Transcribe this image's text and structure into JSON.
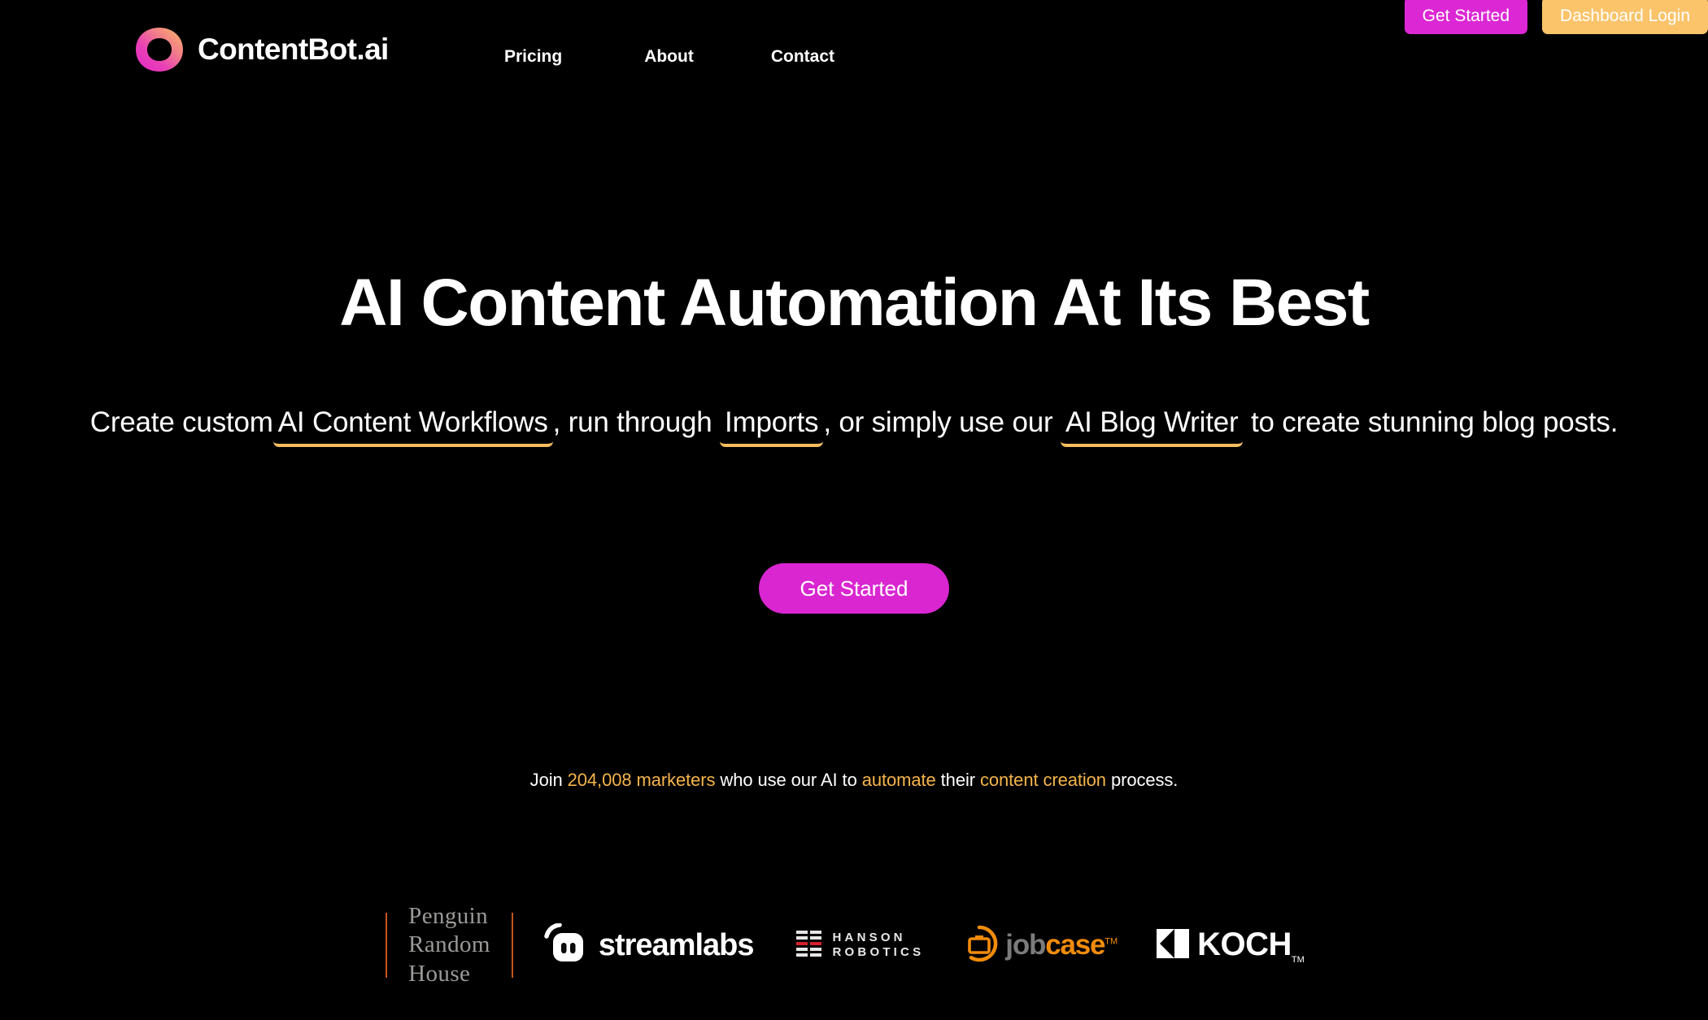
{
  "site": {
    "background_color": "#000000",
    "accent_magenta": "#DC27D4",
    "accent_amber": "#FBC46B",
    "accent_orange": "#F28C0A"
  },
  "header": {
    "logo_icon": "contentbot-ring-logo-icon",
    "brand_name": "ContentBot.ai",
    "nav": [
      {
        "label": "Pricing"
      },
      {
        "label": "About"
      },
      {
        "label": "Contact"
      }
    ],
    "actions": {
      "get_started_label": "Get Started",
      "dashboard_login_label": "Dashboard Login"
    }
  },
  "hero": {
    "title": "AI Content Automation At Its Best",
    "subheading": {
      "part1": "Create custom",
      "link1": "AI Content Workflows",
      "part2": ", run through",
      "link2": "Imports",
      "part3": ", or simply use our",
      "link3": "AI Blog Writer",
      "part4": "to create stunning blog posts."
    },
    "cta_label": "Get Started",
    "social_proof": {
      "lead": "Join",
      "count": "204,008 marketers",
      "mid1": "who use our AI to",
      "highlight1": "automate",
      "mid2": "their",
      "highlight2": "content creation",
      "tail": "process."
    }
  },
  "logo_strip": {
    "logos": [
      {
        "name": "Penguin Random House",
        "line1": "Penguin",
        "line2": "Random",
        "line3": "House"
      },
      {
        "name": "Streamlabs",
        "text": "streamlabs"
      },
      {
        "name": "Hanson Robotics",
        "line1": "HANSON",
        "line2": "ROBOTICS"
      },
      {
        "name": "Jobcase",
        "text_grey": "job",
        "text_orange": "case",
        "tm": "TM"
      },
      {
        "name": "Koch",
        "text": "KOCH",
        "tm": "TM"
      }
    ]
  }
}
